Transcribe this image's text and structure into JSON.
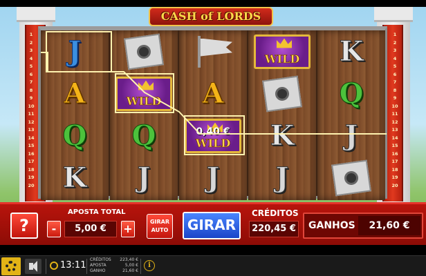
{
  "game": {
    "logo_text": "CASH of LORDS"
  },
  "paylines": {
    "left": [
      "1",
      "2",
      "3",
      "4",
      "5",
      "6",
      "7",
      "8",
      "9",
      "10",
      "11",
      "12",
      "13",
      "14",
      "15",
      "16",
      "17",
      "18",
      "19",
      "20"
    ],
    "right": [
      "1",
      "2",
      "3",
      "4",
      "5",
      "6",
      "7",
      "8",
      "9",
      "10",
      "11",
      "12",
      "13",
      "14",
      "15",
      "16",
      "17",
      "18",
      "19",
      "20"
    ]
  },
  "reels": [
    [
      {
        "symbol": "J",
        "icon": "letter-j"
      },
      {
        "symbol": "A",
        "icon": "letter-a"
      },
      {
        "symbol": "Q",
        "icon": "letter-q"
      },
      {
        "symbol": "K",
        "icon": "letter-k"
      }
    ],
    [
      {
        "symbol": "",
        "icon": "sealed-scroll"
      },
      {
        "symbol": "WILD",
        "icon": "wild-jester"
      },
      {
        "symbol": "Q",
        "icon": "letter-q"
      },
      {
        "symbol": "J",
        "icon": "letter-j"
      }
    ],
    [
      {
        "symbol": "",
        "icon": "flag"
      },
      {
        "symbol": "A",
        "icon": "letter-a"
      },
      {
        "symbol": "WILD",
        "icon": "wild-jester",
        "win": "0,40 €"
      },
      {
        "symbol": "J",
        "icon": "letter-j"
      }
    ],
    [
      {
        "symbol": "WILD",
        "icon": "wild-jester"
      },
      {
        "symbol": "",
        "icon": "sealed-scroll"
      },
      {
        "symbol": "K",
        "icon": "letter-k"
      },
      {
        "symbol": "J",
        "icon": "letter-j"
      }
    ],
    [
      {
        "symbol": "K",
        "icon": "letter-k"
      },
      {
        "symbol": "Q",
        "icon": "letter-q"
      },
      {
        "symbol": "J",
        "icon": "letter-j"
      },
      {
        "symbol": "",
        "icon": "sealed-scroll"
      }
    ]
  ],
  "controls": {
    "help_label": "?",
    "bet_label": "APOSTA TOTAL",
    "minus_label": "-",
    "bet_value": "5,00 €",
    "plus_label": "+",
    "auto_label_1": "GIRAR",
    "auto_label_2": "AUTO",
    "spin_label": "GIRAR",
    "credits_label": "CRÉDITOS",
    "credits_value": "220,45 €",
    "win_label": "GANHOS",
    "win_value": "21,60 €"
  },
  "status": {
    "clock": "13:11",
    "stats": [
      {
        "label": "CRÉDITOS",
        "value": "223,40 €"
      },
      {
        "label": "APOSTA",
        "value": "5,00 €"
      },
      {
        "label": "GANHO",
        "value": "21,60 €"
      }
    ],
    "info_label": "i"
  },
  "colors": {
    "panel": "#b8140c",
    "spin_button": "#2c5ce0",
    "accent_gold": "#e2b316"
  }
}
